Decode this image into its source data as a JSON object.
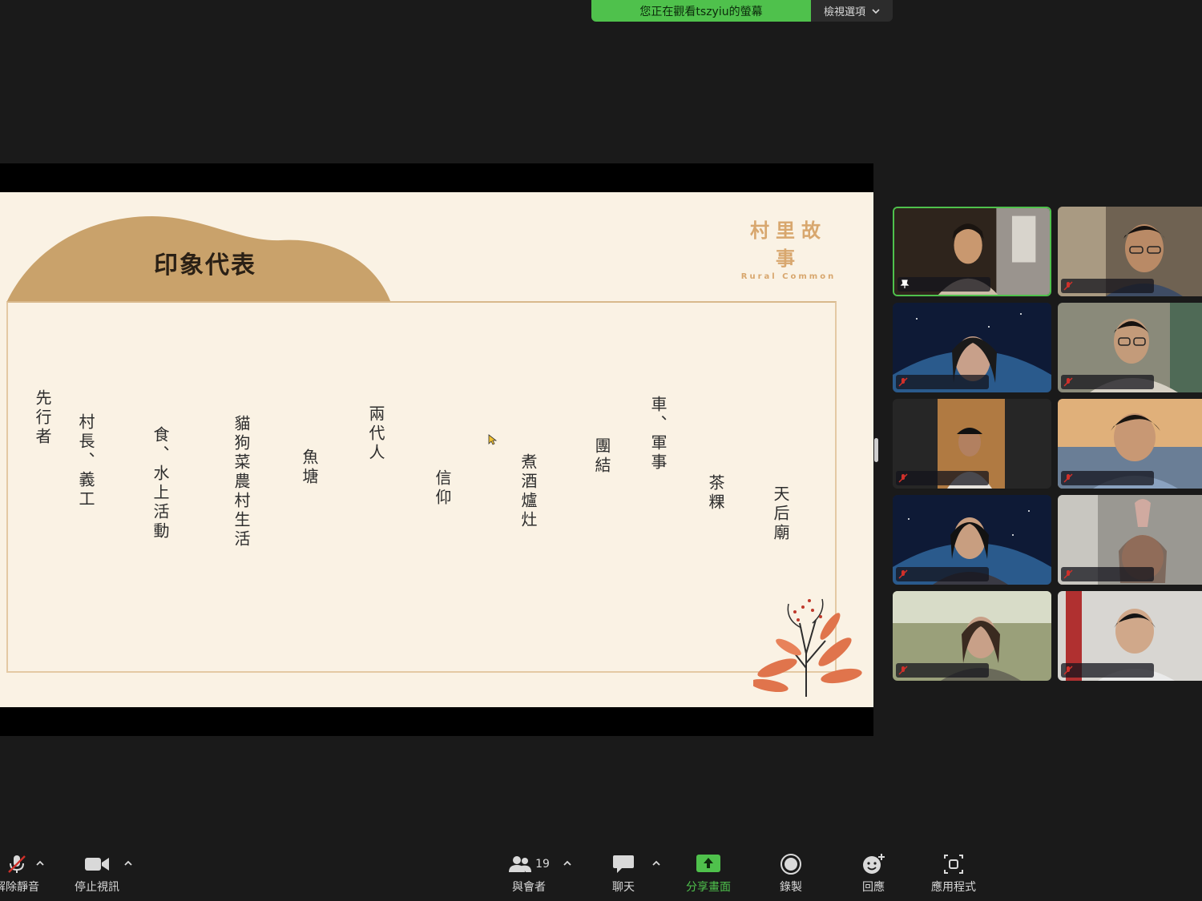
{
  "share_banner": {
    "viewing_text": "您正在觀看tszyiu的螢幕",
    "options_label": "檢視選項"
  },
  "slide": {
    "title": "印象代表",
    "brand_zh": "村里故事",
    "brand_en": "Rural Common",
    "keywords": [
      "先行者",
      "村長、義工",
      "食、水上活動",
      "貓狗菜農村生活",
      "魚塘",
      "兩代人",
      "信仰",
      "煮酒爐灶",
      "團結",
      "車、軍事",
      "茶粿",
      "天后廟"
    ]
  },
  "toolbar": {
    "mute_label": "解除靜音",
    "video_label": "停止視訊",
    "participants_label": "與會者",
    "participants_count": "19",
    "chat_label": "聊天",
    "share_label": "分享畫面",
    "record_label": "錄製",
    "reactions_label": "回應",
    "apps_label": "應用程式"
  },
  "colors": {
    "accent_green": "#4fc14c",
    "slide_bg": "#faf2e4",
    "hill": "#c9a26b",
    "brand": "#d8a76e",
    "muted_red": "#d0302a"
  },
  "icons": [
    "microphone-muted-icon",
    "camera-icon",
    "participants-icon",
    "chat-icon",
    "share-screen-icon",
    "record-icon",
    "reaction-icon",
    "apps-icon",
    "pin-icon",
    "chevron-down-icon",
    "chevron-up-icon"
  ]
}
